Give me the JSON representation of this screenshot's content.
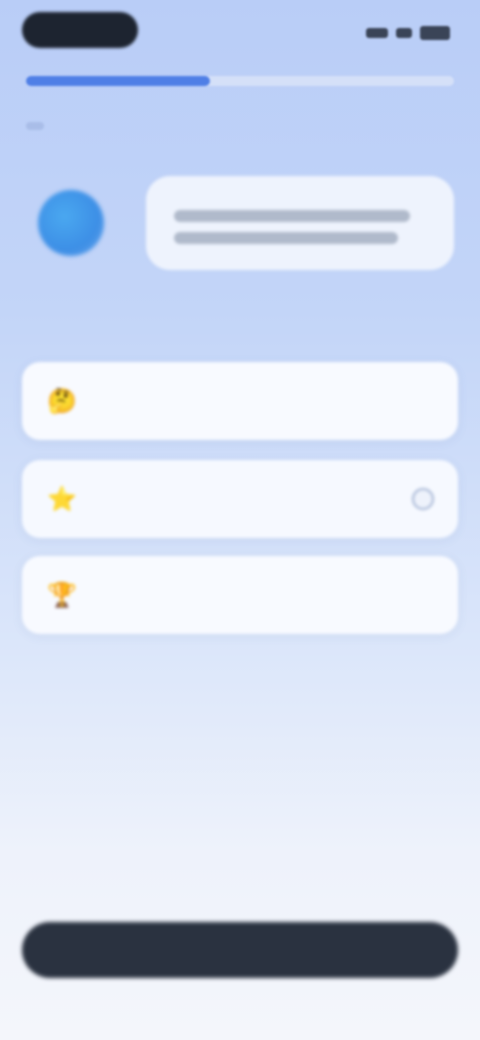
{
  "status_bar": {
    "time": "",
    "signal_icon": "signal-icon",
    "wifi_icon": "wifi-icon",
    "battery_icon": "battery-icon"
  },
  "progress": {
    "fraction": 0.43,
    "fill_color": "#4f7fe6",
    "track_color": "#d5e0f8"
  },
  "assistant": {
    "avatar_icon": "assistant-avatar-icon",
    "message": ""
  },
  "question": {
    "prompt": ""
  },
  "options": [
    {
      "icon": "thinking-emoji-icon",
      "emoji": "🤔",
      "label": "",
      "selected": false
    },
    {
      "icon": "star-emoji-icon",
      "emoji": "⭐",
      "label": "",
      "selected": true
    },
    {
      "icon": "trophy-emoji-icon",
      "emoji": "🏆",
      "label": "",
      "selected": false
    }
  ],
  "footer": {
    "button_label": ""
  },
  "colors": {
    "accent": "#4f7fe6",
    "button_bg": "#2a3240",
    "card_bg": "#f8faff"
  }
}
